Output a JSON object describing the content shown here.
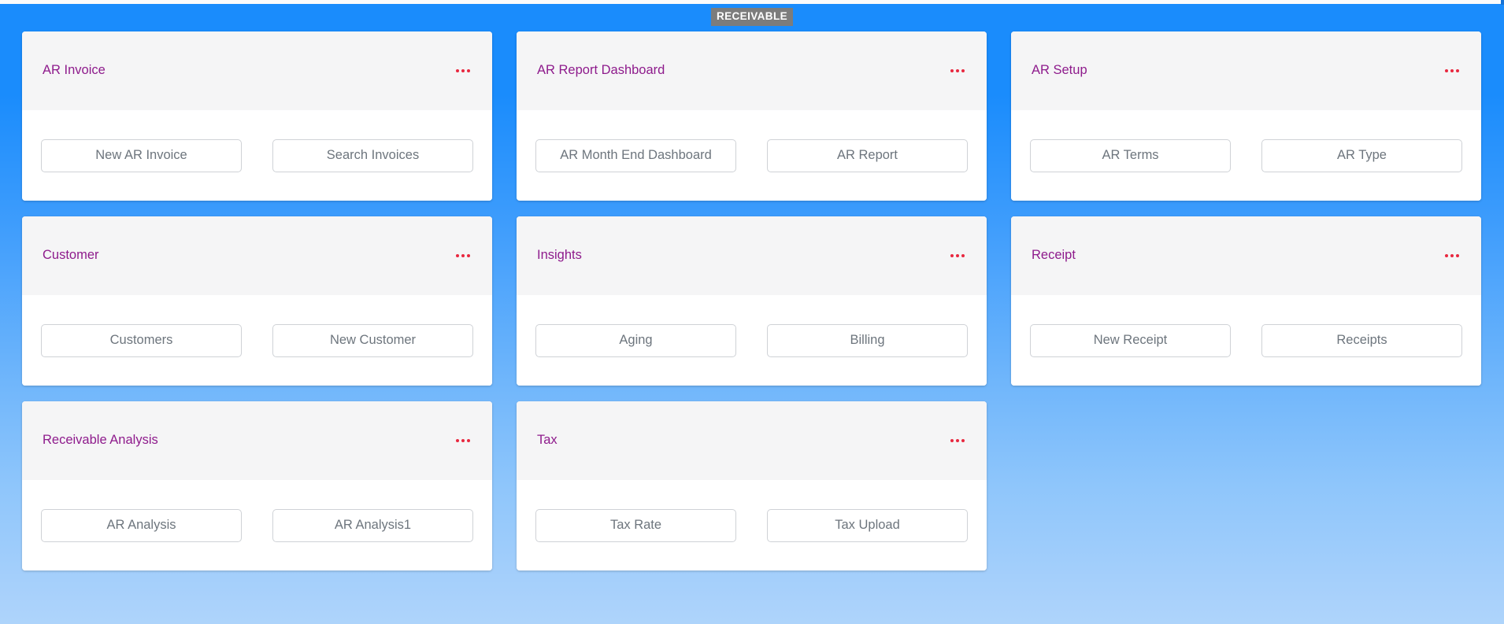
{
  "page": {
    "banner_title": "RECEIVABLE",
    "banner_bg": "#7c7c7c",
    "banner_text_color": "#ffffff",
    "background_top_color": "#1a8cfc",
    "background_bottom_color": "#a9d1fb",
    "card_title_color": "#8e1b8c",
    "menu_dot_color": "#e8283f",
    "button_text_color": "#6d757d",
    "button_border_color": "#cfd2d6",
    "card_header_bg": "#f5f5f6"
  },
  "cards": [
    {
      "title": "AR Invoice",
      "menu_icon": "ellipsis-icon",
      "buttons": [
        {
          "label": "New AR Invoice"
        },
        {
          "label": "Search Invoices"
        }
      ]
    },
    {
      "title": "AR Report Dashboard",
      "menu_icon": "ellipsis-icon",
      "buttons": [
        {
          "label": "AR Month End Dashboard"
        },
        {
          "label": "AR Report"
        }
      ]
    },
    {
      "title": "AR Setup",
      "menu_icon": "ellipsis-icon",
      "buttons": [
        {
          "label": "AR Terms"
        },
        {
          "label": "AR Type"
        }
      ]
    },
    {
      "title": "Customer",
      "menu_icon": "ellipsis-icon",
      "buttons": [
        {
          "label": "Customers"
        },
        {
          "label": "New Customer"
        }
      ]
    },
    {
      "title": "Insights",
      "menu_icon": "ellipsis-icon",
      "buttons": [
        {
          "label": "Aging"
        },
        {
          "label": "Billing"
        }
      ]
    },
    {
      "title": "Receipt",
      "menu_icon": "ellipsis-icon",
      "buttons": [
        {
          "label": "New Receipt"
        },
        {
          "label": "Receipts"
        }
      ]
    },
    {
      "title": "Receivable Analysis",
      "menu_icon": "ellipsis-icon",
      "buttons": [
        {
          "label": "AR Analysis"
        },
        {
          "label": "AR Analysis1"
        }
      ]
    },
    {
      "title": "Tax",
      "menu_icon": "ellipsis-icon",
      "buttons": [
        {
          "label": "Tax Rate"
        },
        {
          "label": "Tax Upload"
        }
      ]
    }
  ]
}
